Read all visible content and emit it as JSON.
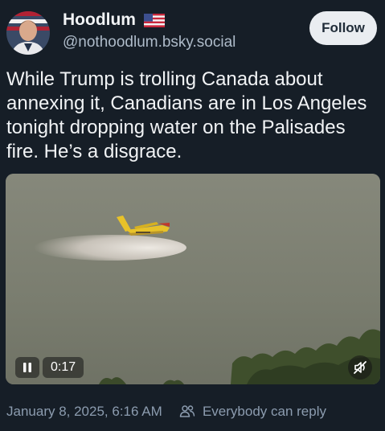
{
  "author": {
    "display_name": "Hoodlum",
    "flag_icon": "us-flag-icon",
    "handle": "@nothoodlum.bsky.social"
  },
  "follow_button": {
    "label": "Follow"
  },
  "post": {
    "text": "While Trump is trolling Canada about annexing it, Canadians are in Los Angeles tonight dropping water on the Palisades fire. He’s a disgrace."
  },
  "video": {
    "elapsed_time": "0:17",
    "play_state_icon": "pause-icon",
    "audio_icon": "muted-speaker-icon"
  },
  "footer": {
    "timestamp": "January 8, 2025, 6:16 AM",
    "reply_setting_icon": "people-icon",
    "reply_setting": "Everybody can reply"
  },
  "colors": {
    "background": "#161e27",
    "text_primary": "#f1f3f5",
    "text_secondary": "#8c9caf",
    "follow_button_bg": "#eaedf1"
  }
}
